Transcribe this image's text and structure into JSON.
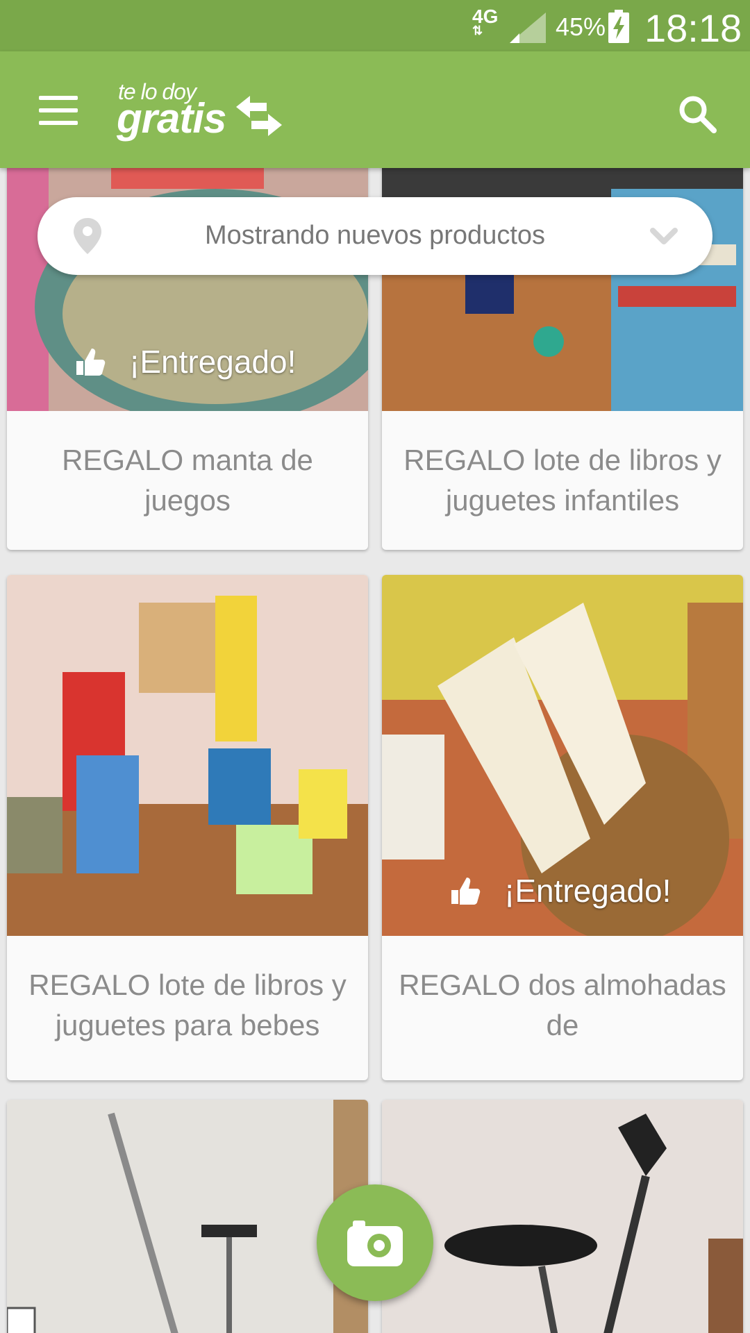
{
  "status_bar": {
    "network": "4G",
    "battery_percent": "45%",
    "time": "18:18"
  },
  "app_bar": {
    "logo_top": "te lo doy",
    "logo_main": "gratis"
  },
  "location_filter": {
    "label": "Mostrando nuevos productos"
  },
  "products": [
    {
      "title": "REGALO manta de juegos",
      "status": "¡Entregado!",
      "icon": "thumbs-up-icon"
    },
    {
      "title": "REGALO lote de libros y juguetes infantiles",
      "status": ""
    },
    {
      "title": "REGALO lote de libros y juguetes para bebes",
      "status": ""
    },
    {
      "title": "REGALO dos almohadas de",
      "status": "¡Entregado!",
      "icon": "thumbs-up-icon"
    },
    {
      "title": "",
      "status": ""
    },
    {
      "title": "",
      "status": ""
    }
  ],
  "icons": {
    "menu": "hamburger-menu-icon",
    "search": "search-icon",
    "location": "location-pin-icon",
    "dropdown": "chevron-down-icon",
    "fab": "camera-icon"
  },
  "colors": {
    "status_bar": "#7aa84a",
    "app_bar": "#8bbb56",
    "fab": "#8bbb56",
    "title_text": "#8b8b8b"
  }
}
